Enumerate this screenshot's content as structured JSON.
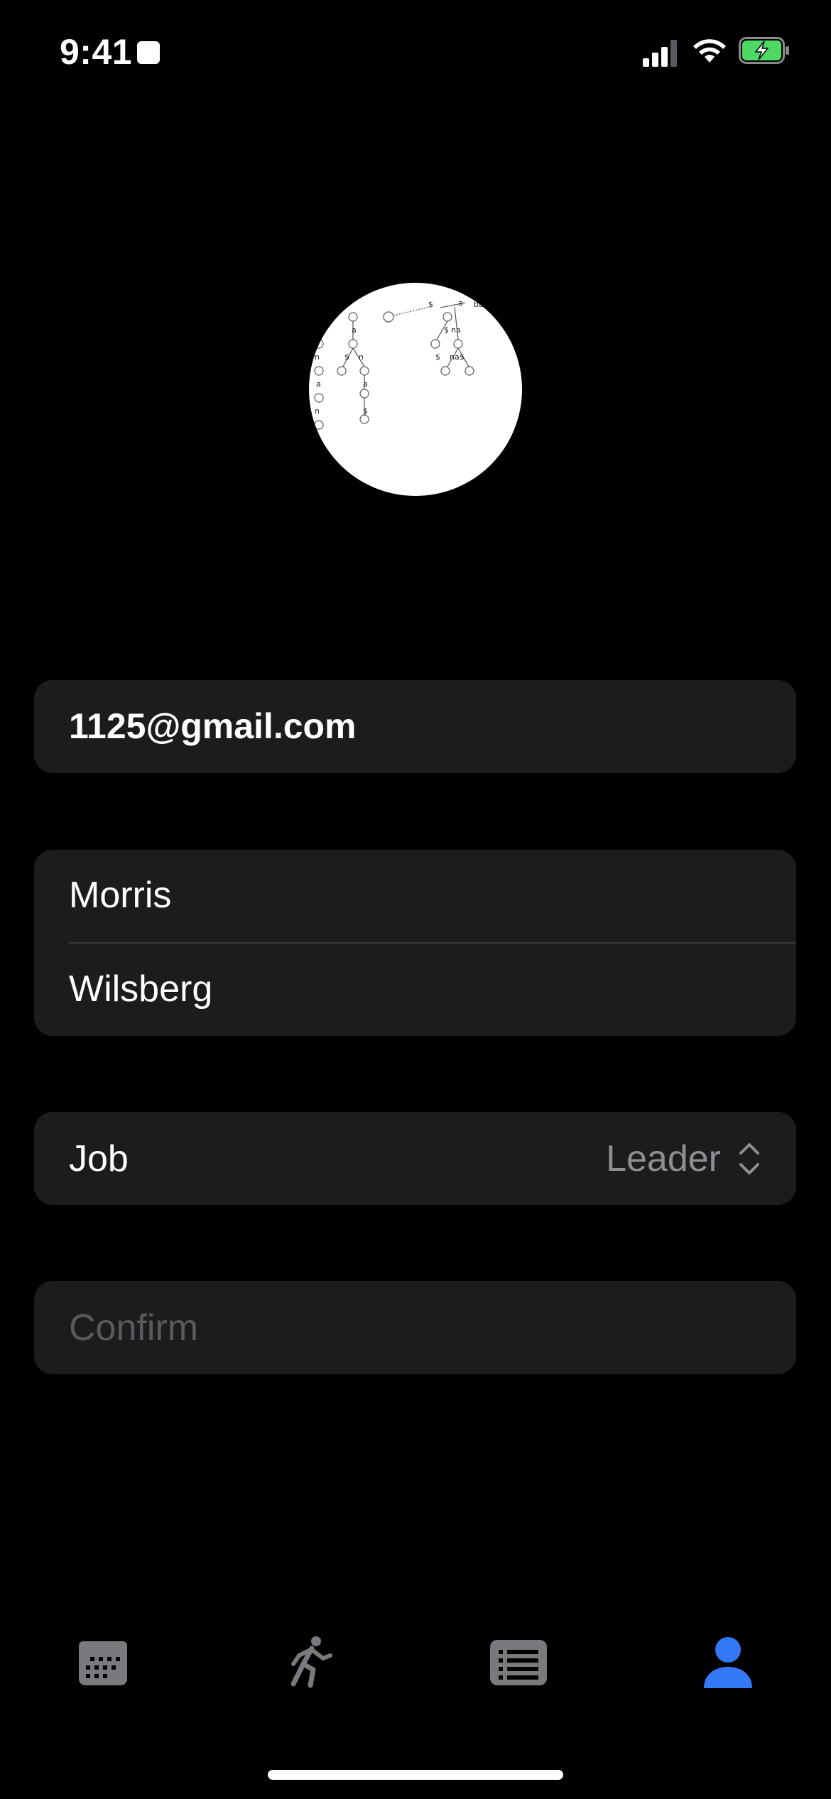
{
  "status_bar": {
    "time": "9:41"
  },
  "profile": {
    "email": "1125@gmail.com",
    "first_name": "Morris",
    "last_name": "Wilsberg",
    "job_label": "Job",
    "job_value": "Leader",
    "confirm_label": "Confirm"
  },
  "tabs": [
    {
      "name": "calendar",
      "icon": "calendar-icon",
      "active": false
    },
    {
      "name": "activity",
      "icon": "running-figure-icon",
      "active": false
    },
    {
      "name": "list",
      "icon": "list-icon",
      "active": false
    },
    {
      "name": "profile",
      "icon": "person-icon",
      "active": true
    }
  ],
  "colors": {
    "background": "#000000",
    "card": "#1c1c1e",
    "accent": "#3478f6",
    "inactive_icon": "#7a7a7e",
    "secondary_text": "#8e8e93",
    "battery_fill": "#4cd964"
  }
}
